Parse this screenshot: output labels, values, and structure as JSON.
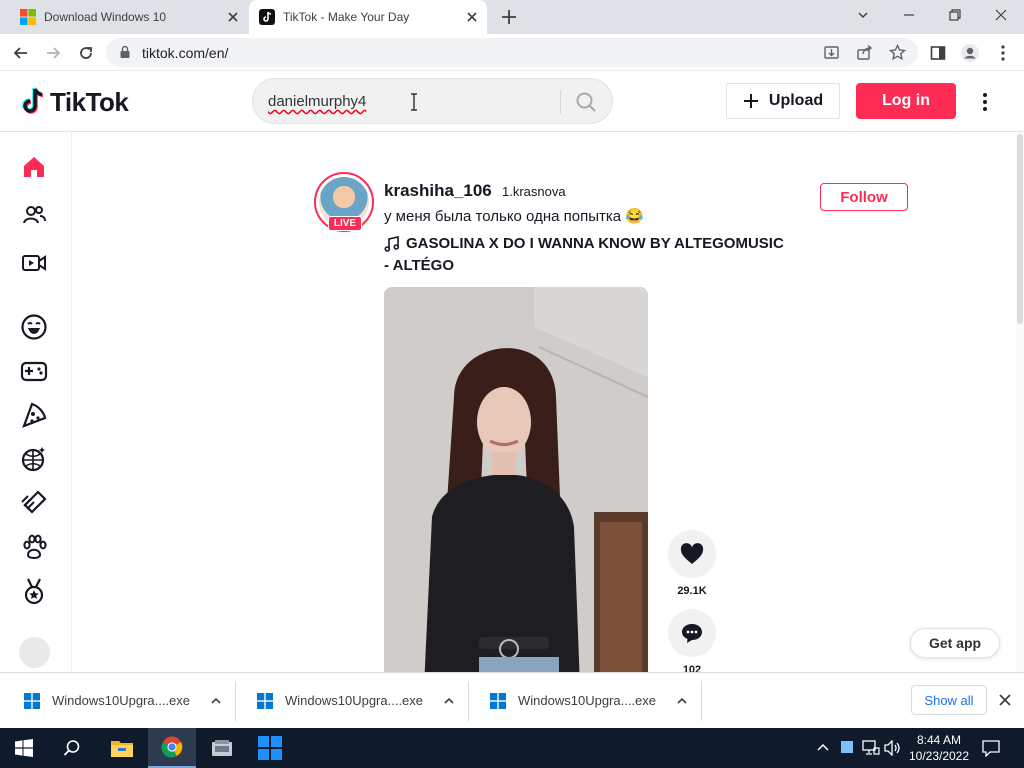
{
  "browser": {
    "tabs": [
      {
        "title": "Download Windows 10",
        "active": false
      },
      {
        "title": "TikTok - Make Your Day",
        "active": true
      }
    ],
    "url": "tiktok.com/en/"
  },
  "header": {
    "logo_text": "TikTok",
    "search_value": "danielmurphy4",
    "upload_label": "Upload",
    "login_label": "Log in"
  },
  "post": {
    "username": "krashiha_106",
    "nickname": "1.krasnova",
    "live_badge": "LIVE",
    "caption": "у меня была только одна попытка 😂",
    "music_line1": "GASOLINA X DO I WANNA KNOW BY ALTEGOMUSIC",
    "music_line2": "- ALTÉGO",
    "follow_label": "Follow",
    "likes": "29.1K",
    "comments": "102"
  },
  "get_app_label": "Get app",
  "downloads": {
    "items": [
      {
        "name": "Windows10Upgra....exe"
      },
      {
        "name": "Windows10Upgra....exe"
      },
      {
        "name": "Windows10Upgra....exe"
      }
    ],
    "show_all_label": "Show all"
  },
  "taskbar": {
    "time": "8:44 AM",
    "date": "10/23/2022"
  },
  "colors": {
    "brand": "#fe2c55",
    "tab_strip": "#dee1e6",
    "taskbar": "#0f1a2a"
  }
}
